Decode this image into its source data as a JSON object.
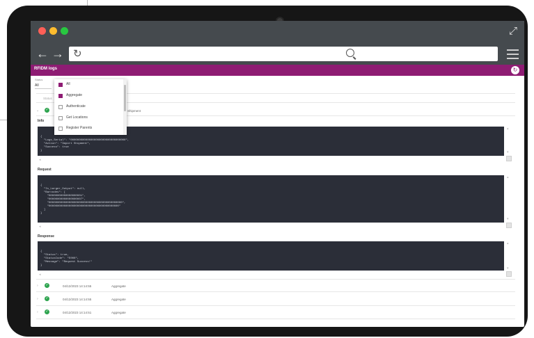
{
  "browser": {
    "window_dots": [
      "#ff5f57",
      "#febc2e",
      "#28c840"
    ],
    "back_icon": "arrow-left-icon",
    "forward_icon": "arrow-right-icon",
    "reload_icon": "reload-icon",
    "search_icon": "search-icon",
    "menu_icon": "hamburger-icon",
    "expand_icon": "expand-icon",
    "url": "",
    "search_query": ""
  },
  "app": {
    "title": "RFIDM logs",
    "header_color": "#8e1c73",
    "action_icon": "refresh-icon"
  },
  "filter": {
    "label": "Status",
    "value": "All",
    "options": [
      {
        "label": "All",
        "checked": true
      },
      {
        "label": "Aggregate",
        "checked": true
      },
      {
        "label": "Authenticate",
        "checked": false
      },
      {
        "label": "Get Locations",
        "checked": false
      },
      {
        "label": "Register Parents",
        "checked": false
      }
    ]
  },
  "table": {
    "column_hint": "Status"
  },
  "expanded_row": {
    "type_text": "Shipment"
  },
  "sections": [
    {
      "title": "Info",
      "lines": [
        "{",
        "  \"Logs_Serial\": \"000000000000000000000000000000000\",",
        "  \"Action\": \"Import Shipment\",",
        "  \"Success\": true",
        "}"
      ]
    },
    {
      "title": "Request",
      "lines": [
        "{",
        "  \"Is_Larger_Output\": null,",
        "  \"Barcodes\": [",
        "    \"00000000000000000001\",",
        "    \"00000000000000000007\",",
        "    \"00000000000000000000000000000000000000000000\",",
        "    \"000000000000000000000000000000000000000000\"",
        "  ]",
        "}"
      ]
    },
    {
      "title": "Response",
      "lines": [
        "{",
        "  \"Status\": true,",
        "  \"StatusCode\": \"E000\",",
        "  \"Message\": \"Request Success!\"",
        "}"
      ]
    }
  ],
  "rows": [
    {
      "timestamp": "04/12/2023 14:14:55",
      "type": "Aggregate",
      "status": "ok"
    },
    {
      "timestamp": "04/12/2023 14:14:55",
      "type": "Aggregate",
      "status": "ok"
    },
    {
      "timestamp": "04/12/2023 14:14:51",
      "type": "Aggregate",
      "status": "ok"
    }
  ]
}
